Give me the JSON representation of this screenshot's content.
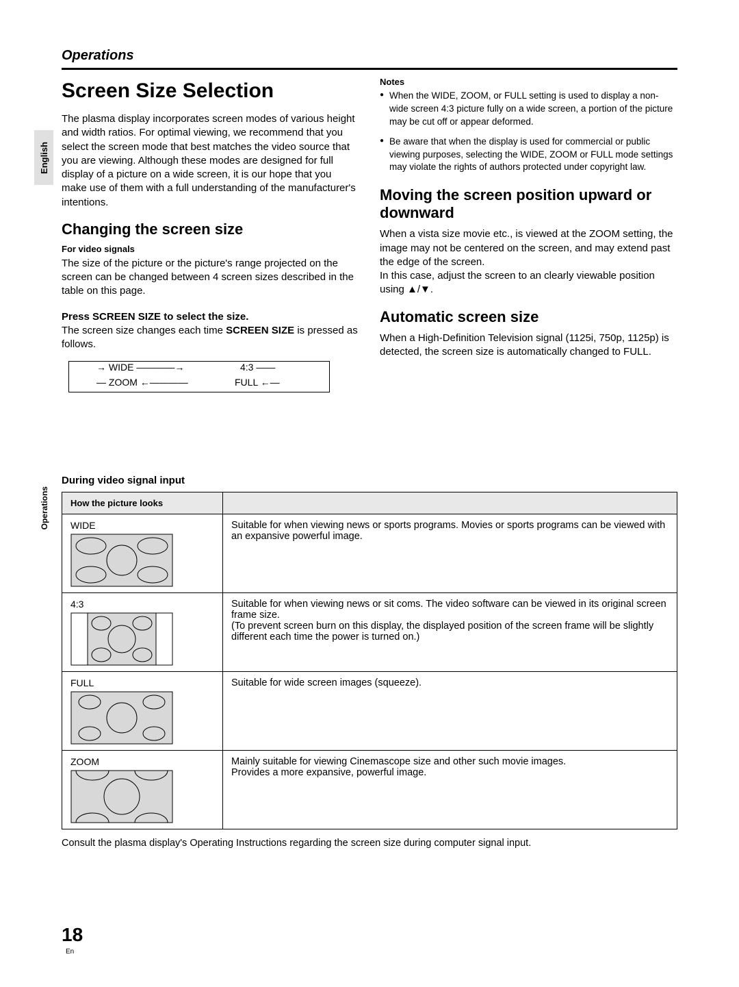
{
  "header": {
    "section": "Operations"
  },
  "side": {
    "lang_tab": "English",
    "ops_tab": "Operations"
  },
  "left": {
    "title": "Screen Size Selection",
    "intro": "The plasma display incorporates screen modes of various height and width ratios. For optimal viewing, we recommend that you select the screen mode that best matches the video source that you are viewing. Although these modes are designed for full display of a picture on a wide screen, it is our hope that you make use of them with a full understanding of the manufacturer's intentions.",
    "h2": "Changing the screen size",
    "for_video": "For video signals",
    "for_video_body": "The size of the picture or the picture's range projected on the screen can be changed between 4 screen sizes described in the table on this page.",
    "step_head": "Press SCREEN SIZE to select the size.",
    "step_body_a": "The screen size changes each time ",
    "step_body_b": "SCREEN SIZE",
    "step_body_c": " is pressed as follows.",
    "cycle": {
      "wide": "WIDE",
      "ar": "4:3",
      "full": "FULL",
      "zoom": "ZOOM"
    }
  },
  "right": {
    "notes_head": "Notes",
    "note1": "When the WIDE, ZOOM, or FULL setting is used to display a non-wide screen 4:3 picture fully on a wide screen, a portion of the picture may be cut off or appear deformed.",
    "note2": "Be aware that when the display is used for commercial or public viewing purposes, selecting the WIDE, ZOOM or FULL mode settings may violate the rights of authors protected under copyright law.",
    "h2a": "Moving the screen position upward or downward",
    "move_body": "When a vista size movie etc., is viewed at the ZOOM setting, the image may not be centered on the screen, and may extend past the edge of the screen.\nIn this case, adjust the screen to an clearly viewable position using ▲/▼.",
    "h2b": "Automatic screen size",
    "auto_body": "When a High-Definition Television signal (1125i, 750p, 1125p) is detected, the screen size is automatically changed to FULL."
  },
  "table": {
    "caption": "During video signal input",
    "col1": "How the picture looks",
    "rows": [
      {
        "mode": "WIDE",
        "shape": "wide",
        "desc": "Suitable for when viewing news or sports programs. Movies or sports programs can be viewed with an expansive powerful image."
      },
      {
        "mode": "4:3",
        "shape": "43",
        "desc": "Suitable for when viewing news or sit coms. The video software can be viewed in its original screen frame size.\n(To prevent screen burn on this display, the displayed position of the screen frame will be slightly different each time the power is turned on.)"
      },
      {
        "mode": "FULL",
        "shape": "full",
        "desc": "Suitable for wide screen images (squeeze)."
      },
      {
        "mode": "ZOOM",
        "shape": "zoom",
        "desc": "Mainly suitable for viewing Cinemascope size and other such movie images.\nProvides a more expansive, powerful image."
      }
    ],
    "footnote": "Consult the plasma display's Operating Instructions regarding the screen size during computer signal input."
  },
  "footer": {
    "page": "18",
    "lang": "En"
  }
}
